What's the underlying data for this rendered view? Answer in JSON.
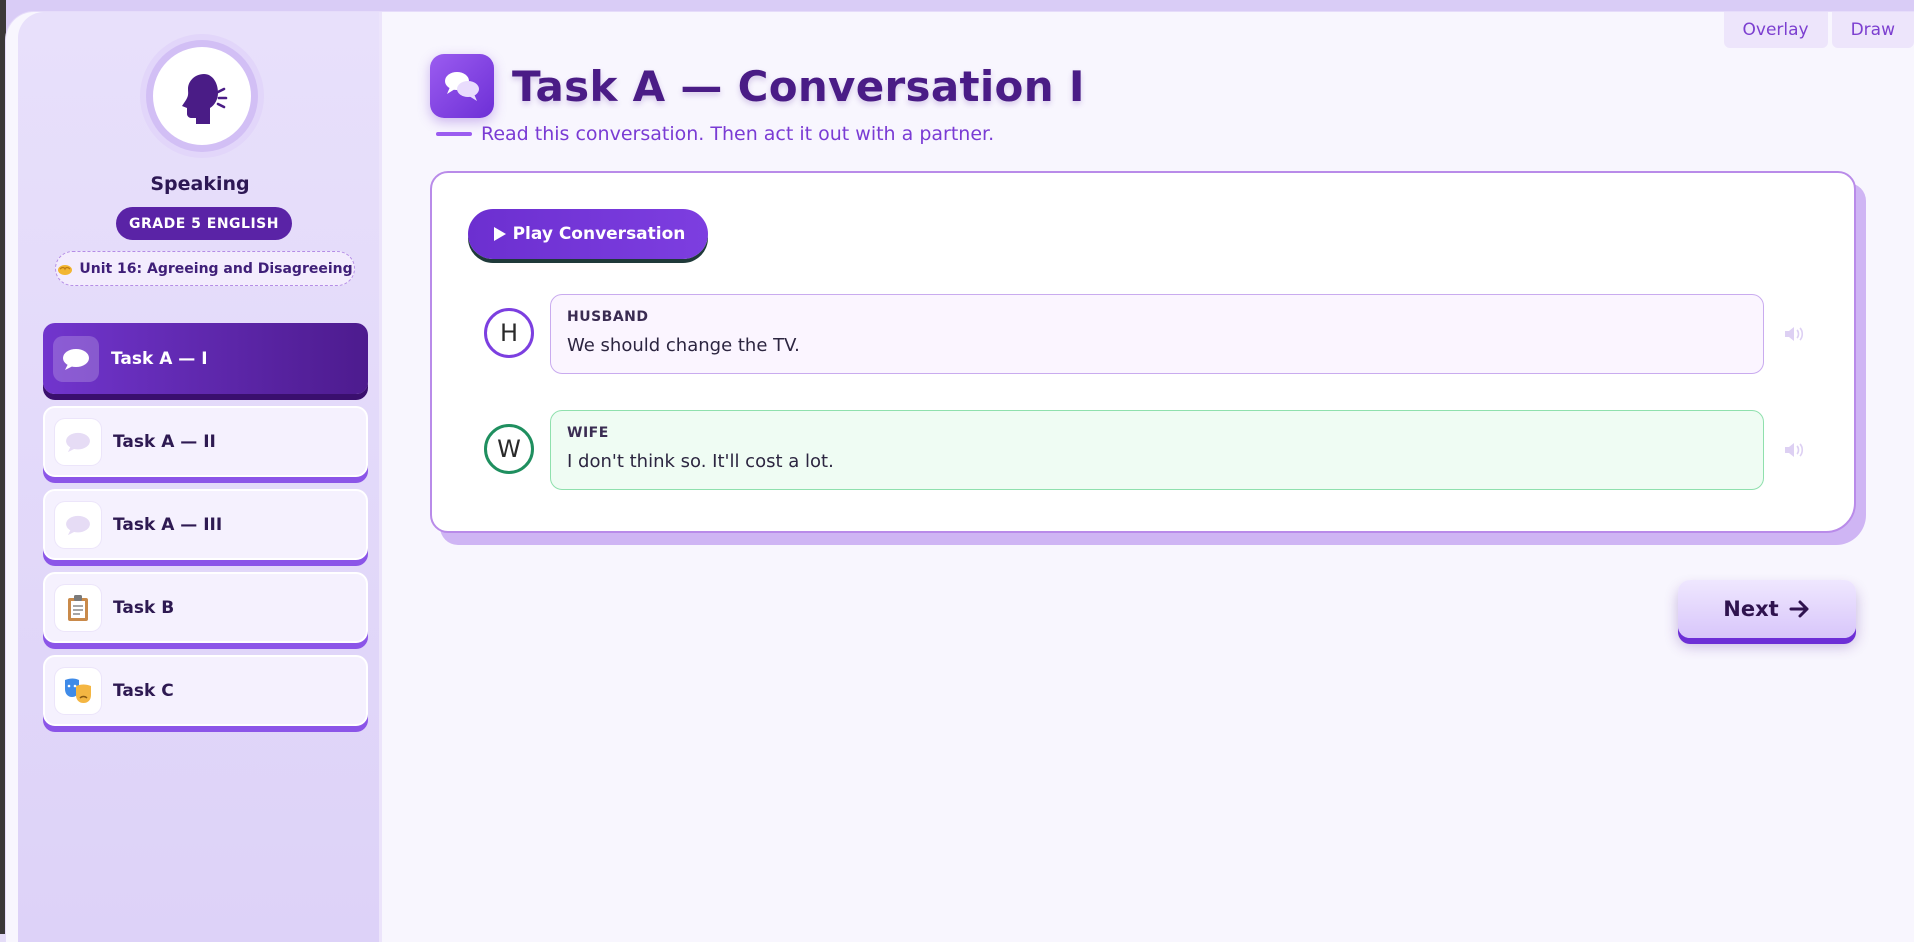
{
  "tools": {
    "overlay": "Overlay",
    "draw": "Draw"
  },
  "sidebar": {
    "subject": "Speaking",
    "grade": "GRADE 5 ENGLISH",
    "unit": "Unit 16: Agreeing and Disagreeing",
    "items": [
      {
        "label": "Task A — I",
        "icon": "speech-bubble-icon",
        "active": true
      },
      {
        "label": "Task A — II",
        "icon": "speech-bubble-icon",
        "active": false
      },
      {
        "label": "Task A — III",
        "icon": "speech-bubble-icon",
        "active": false
      },
      {
        "label": "Task B",
        "icon": "clipboard-icon",
        "active": false
      },
      {
        "label": "Task C",
        "icon": "theater-masks-icon",
        "active": false
      }
    ]
  },
  "main": {
    "title": "Task A — Conversation I",
    "subtitle": "Read this conversation. Then act it out with a partner.",
    "play_label": "Play Conversation",
    "lines": [
      {
        "initial": "H",
        "speaker": "HUSBAND",
        "text": "We should change the TV."
      },
      {
        "initial": "W",
        "speaker": "WIFE",
        "text": "I don't think so. It'll cost a lot."
      }
    ],
    "next_label": "Next"
  },
  "colors": {
    "accent": "#7135cd",
    "husband_ring": "#7c3fe0",
    "husband_bubble": "#fbf5ff",
    "wife_ring": "#1f8f5f",
    "wife_bubble": "#effcf3"
  }
}
